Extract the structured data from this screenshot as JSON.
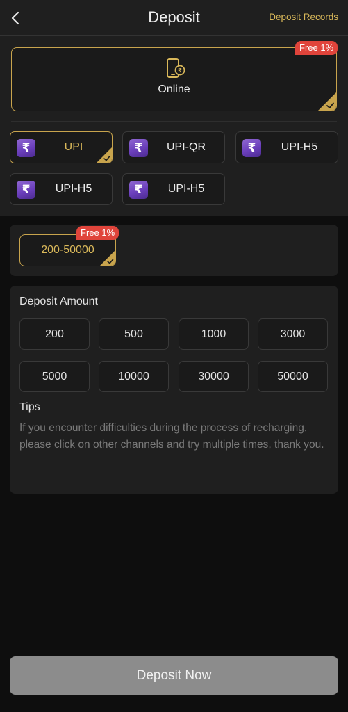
{
  "header": {
    "title": "Deposit",
    "records_label": "Deposit Records"
  },
  "method": {
    "label": "Online",
    "badge": "Free 1%"
  },
  "channels": [
    {
      "label": "UPI",
      "selected": true
    },
    {
      "label": "UPI-QR",
      "selected": false
    },
    {
      "label": "UPI-H5",
      "selected": false
    },
    {
      "label": "UPI-H5",
      "selected": false
    },
    {
      "label": "UPI-H5",
      "selected": false
    }
  ],
  "range": {
    "label": "200-50000",
    "badge": "Free 1%"
  },
  "amount": {
    "title": "Deposit Amount",
    "options": [
      "200",
      "500",
      "1000",
      "3000",
      "5000",
      "10000",
      "30000",
      "50000"
    ]
  },
  "tips": {
    "title": "Tips",
    "text": "If you encounter difficulties during the process of recharging, please click on other channels and try multiple times, thank you."
  },
  "submit_label": "Deposit Now",
  "colors": {
    "accent_gold": "#c8a44d",
    "badge_red": "#e0443b",
    "button_disabled": "#8c8c8c"
  }
}
